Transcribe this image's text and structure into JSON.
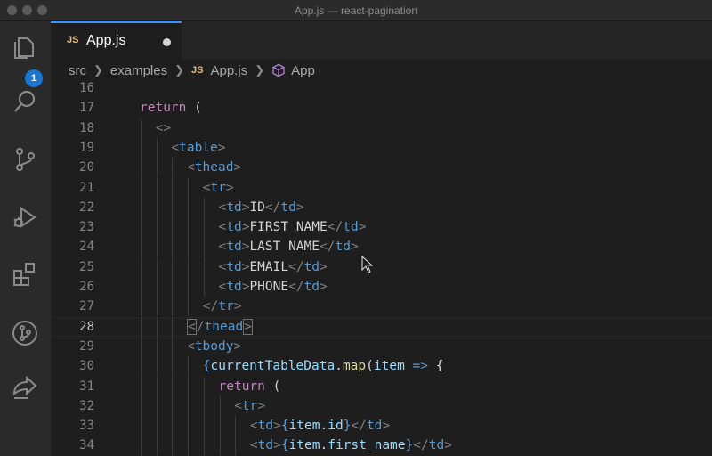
{
  "window": {
    "title": "App.js — react-pagination"
  },
  "activity_bar": {
    "items": [
      {
        "name": "explorer-icon"
      },
      {
        "name": "search-icon"
      },
      {
        "name": "source-control-icon"
      },
      {
        "name": "run-debug-icon"
      },
      {
        "name": "extensions-icon"
      },
      {
        "name": "git-graph-icon"
      },
      {
        "name": "live-share-icon"
      }
    ],
    "badge": "1"
  },
  "tab": {
    "lang": "JS",
    "label": "App.js"
  },
  "breadcrumb": {
    "items": [
      "src",
      "examples",
      "App.js",
      "App"
    ],
    "lang": "JS"
  },
  "editor": {
    "active_line": 28,
    "lines": [
      {
        "n": "16",
        "indent": 0,
        "tokens": []
      },
      {
        "n": "17",
        "indent": 0,
        "tokens": [
          [
            "kw",
            "return"
          ],
          [
            "pn",
            " ("
          ]
        ]
      },
      {
        "n": "18",
        "indent": 1,
        "tokens": [
          [
            "tg",
            "<>"
          ]
        ]
      },
      {
        "n": "19",
        "indent": 2,
        "tokens": [
          [
            "tg",
            "<"
          ],
          [
            "tn",
            "table"
          ],
          [
            "tg",
            ">"
          ]
        ]
      },
      {
        "n": "20",
        "indent": 3,
        "tokens": [
          [
            "tg",
            "<"
          ],
          [
            "tn",
            "thead"
          ],
          [
            "tg",
            ">"
          ]
        ]
      },
      {
        "n": "21",
        "indent": 4,
        "tokens": [
          [
            "tg",
            "<"
          ],
          [
            "tn",
            "tr"
          ],
          [
            "tg",
            ">"
          ]
        ]
      },
      {
        "n": "22",
        "indent": 5,
        "tokens": [
          [
            "tg",
            "<"
          ],
          [
            "tn",
            "td"
          ],
          [
            "tg",
            ">"
          ],
          [
            "tx",
            "ID"
          ],
          [
            "tg",
            "</"
          ],
          [
            "tn",
            "td"
          ],
          [
            "tg",
            ">"
          ]
        ]
      },
      {
        "n": "23",
        "indent": 5,
        "tokens": [
          [
            "tg",
            "<"
          ],
          [
            "tn",
            "td"
          ],
          [
            "tg",
            ">"
          ],
          [
            "tx",
            "FIRST NAME"
          ],
          [
            "tg",
            "</"
          ],
          [
            "tn",
            "td"
          ],
          [
            "tg",
            ">"
          ]
        ]
      },
      {
        "n": "24",
        "indent": 5,
        "tokens": [
          [
            "tg",
            "<"
          ],
          [
            "tn",
            "td"
          ],
          [
            "tg",
            ">"
          ],
          [
            "tx",
            "LAST NAME"
          ],
          [
            "tg",
            "</"
          ],
          [
            "tn",
            "td"
          ],
          [
            "tg",
            ">"
          ]
        ]
      },
      {
        "n": "25",
        "indent": 5,
        "tokens": [
          [
            "tg",
            "<"
          ],
          [
            "tn",
            "td"
          ],
          [
            "tg",
            ">"
          ],
          [
            "tx",
            "EMAIL"
          ],
          [
            "tg",
            "</"
          ],
          [
            "tn",
            "td"
          ],
          [
            "tg",
            ">"
          ]
        ]
      },
      {
        "n": "26",
        "indent": 5,
        "tokens": [
          [
            "tg",
            "<"
          ],
          [
            "tn",
            "td"
          ],
          [
            "tg",
            ">"
          ],
          [
            "tx",
            "PHONE"
          ],
          [
            "tg",
            "</"
          ],
          [
            "tn",
            "td"
          ],
          [
            "tg",
            ">"
          ]
        ]
      },
      {
        "n": "27",
        "indent": 4,
        "tokens": [
          [
            "tg",
            "</"
          ],
          [
            "tn",
            "tr"
          ],
          [
            "tg",
            ">"
          ]
        ]
      },
      {
        "n": "28",
        "indent": 3,
        "tokens": [
          [
            "tg box",
            "<"
          ],
          [
            "tg",
            "/"
          ],
          [
            "tn",
            "thead"
          ],
          [
            "tg box",
            ">"
          ]
        ]
      },
      {
        "n": "29",
        "indent": 3,
        "tokens": [
          [
            "tg",
            "<"
          ],
          [
            "tn",
            "tbody"
          ],
          [
            "tg",
            ">"
          ]
        ]
      },
      {
        "n": "30",
        "indent": 4,
        "tokens": [
          [
            "br",
            "{"
          ],
          [
            "vr",
            "currentTableData"
          ],
          [
            "pn",
            "."
          ],
          [
            "fn",
            "map"
          ],
          [
            "pn",
            "("
          ],
          [
            "vr",
            "item"
          ],
          [
            "pn",
            " "
          ],
          [
            "ar",
            "=>"
          ],
          [
            "pn",
            " {"
          ]
        ]
      },
      {
        "n": "31",
        "indent": 5,
        "tokens": [
          [
            "kw",
            "return"
          ],
          [
            "pn",
            " ("
          ]
        ]
      },
      {
        "n": "32",
        "indent": 6,
        "tokens": [
          [
            "tg",
            "<"
          ],
          [
            "tn",
            "tr"
          ],
          [
            "tg",
            ">"
          ]
        ]
      },
      {
        "n": "33",
        "indent": 7,
        "tokens": [
          [
            "tg",
            "<"
          ],
          [
            "tn",
            "td"
          ],
          [
            "tg",
            ">"
          ],
          [
            "br",
            "{"
          ],
          [
            "vr",
            "item"
          ],
          [
            "pn",
            "."
          ],
          [
            "vr",
            "id"
          ],
          [
            "br",
            "}"
          ],
          [
            "tg",
            "</"
          ],
          [
            "tn",
            "td"
          ],
          [
            "tg",
            ">"
          ]
        ]
      },
      {
        "n": "34",
        "indent": 7,
        "tokens": [
          [
            "tg",
            "<"
          ],
          [
            "tn",
            "td"
          ],
          [
            "tg",
            ">"
          ],
          [
            "br",
            "{"
          ],
          [
            "vr",
            "item"
          ],
          [
            "pn",
            "."
          ],
          [
            "vr",
            "first_name"
          ],
          [
            "br",
            "}"
          ],
          [
            "tg",
            "</"
          ],
          [
            "tn",
            "td"
          ],
          [
            "tg",
            ">"
          ]
        ]
      }
    ]
  }
}
